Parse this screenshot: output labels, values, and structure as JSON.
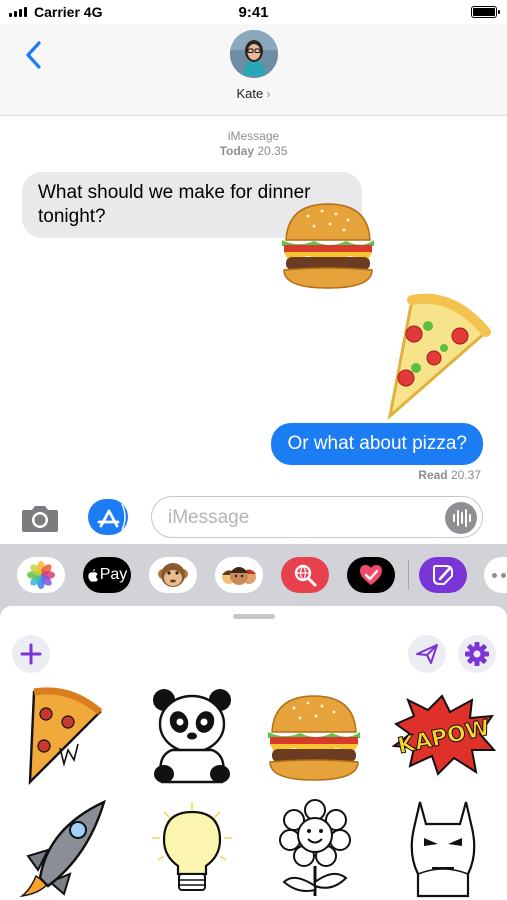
{
  "status_bar": {
    "carrier": "Carrier 4G",
    "time": "9:41"
  },
  "header": {
    "contact_name": "Kate",
    "contact_chevron": "›",
    "avatar_icon": "contact-avatar"
  },
  "conversation": {
    "service": "iMessage",
    "timestamp_day": "Today",
    "timestamp_time": "20.35",
    "messages": [
      {
        "direction": "incoming",
        "text": "What should we make for dinner tonight?"
      },
      {
        "direction": "outgoing",
        "text": "Or what about pizza?"
      }
    ],
    "read_label": "Read",
    "read_time": "20.37",
    "stickers_in_chat": [
      "burger-sticker",
      "pizza-slice-sticker"
    ]
  },
  "input_bar": {
    "placeholder": "iMessage",
    "camera_icon": "camera-icon",
    "appstore_icon": "app-store-icon",
    "audio_icon": "waveform-icon"
  },
  "app_drawer": {
    "apps": [
      {
        "name": "photos",
        "icon": "photos-icon"
      },
      {
        "name": "apple-pay",
        "label": "Pay",
        "icon": "apple-icon"
      },
      {
        "name": "animoji",
        "icon": "monkey-icon"
      },
      {
        "name": "memoji",
        "icon": "memoji-icon"
      },
      {
        "name": "images-search",
        "icon": "search-globe-icon"
      },
      {
        "name": "digital-touch",
        "icon": "heart-icon"
      },
      {
        "name": "sticker-app",
        "icon": "sticker-pen-icon"
      },
      {
        "name": "more",
        "icon": "more-dots-icon"
      }
    ]
  },
  "sticker_panel": {
    "add_icon": "plus-icon",
    "send_icon": "paper-plane-icon",
    "settings_icon": "gear-icon",
    "stickers": [
      "pizza-sticker",
      "panda-sticker",
      "burger-sticker",
      "kapow-sticker",
      "rocket-sticker",
      "lightbulb-sticker",
      "flower-sticker",
      "batman-sticker"
    ],
    "kapow_text": "KAPOW"
  },
  "colors": {
    "accent_blue": "#1c7cf4",
    "incoming_bubble": "#e9e9eb",
    "sticker_app_purple": "#7a35d6",
    "drawer_gray": "#d1d3d8"
  }
}
